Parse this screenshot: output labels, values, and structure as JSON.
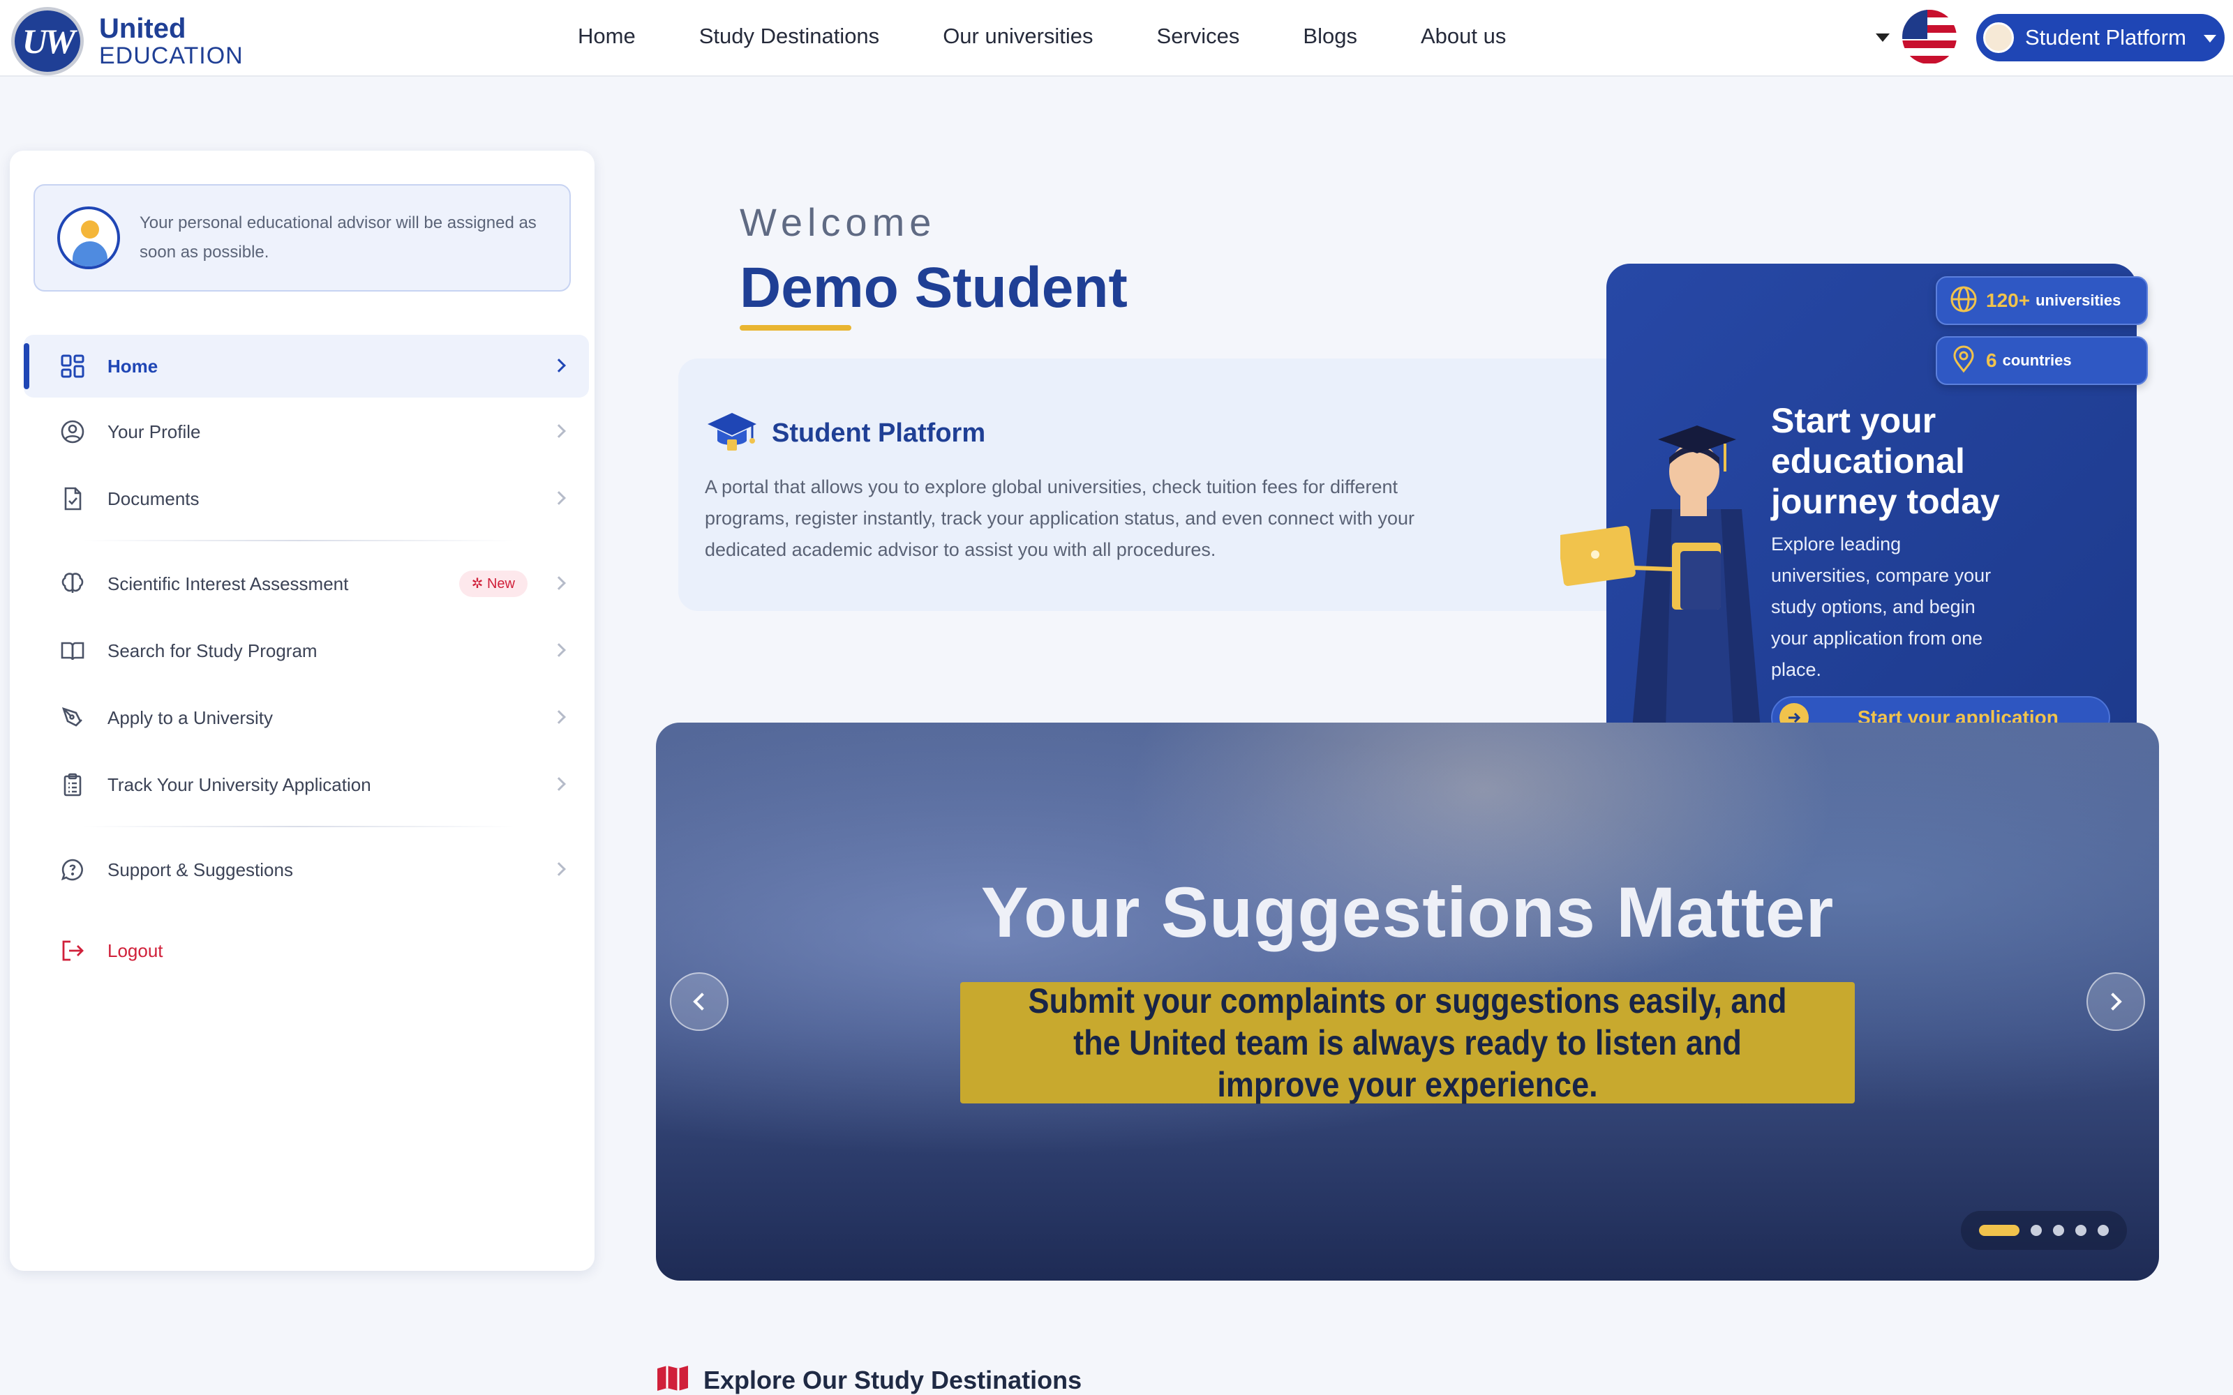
{
  "logo": {
    "line1": "United",
    "line2": "EDUCATION",
    "mark": "UW"
  },
  "nav": {
    "links": [
      "Home",
      "Study Destinations",
      "Our universities",
      "Services",
      "Blogs",
      "About us"
    ],
    "language_icon": "us-flag-icon",
    "platform_button": "Student Platform"
  },
  "sidebar": {
    "advisor_message": "Your personal educational advisor will be assigned as soon as possible.",
    "items": [
      {
        "label": "Home",
        "icon": "dashboard-grid-icon",
        "active": true
      },
      {
        "label": "Your Profile",
        "icon": "user-circle-icon"
      },
      {
        "label": "Documents",
        "icon": "document-check-icon"
      },
      {
        "label": "Scientific Interest Assessment",
        "icon": "brain-icon",
        "badge": "New"
      },
      {
        "label": "Search for Study Program",
        "icon": "open-book-icon"
      },
      {
        "label": "Apply to a University",
        "icon": "pen-tool-icon"
      },
      {
        "label": "Track Your University Application",
        "icon": "clipboard-list-icon"
      },
      {
        "label": "Support & Suggestions",
        "icon": "chat-bubble-icon"
      },
      {
        "label": "Logout",
        "icon": "logout-icon"
      }
    ]
  },
  "welcome": {
    "label": "Welcome",
    "name": "Demo Student"
  },
  "intro": {
    "title": "Student Platform",
    "text": "A portal that allows you to explore global universities, check tuition fees for different programs, register instantly, track your application status, and even connect with your dedicated academic advisor to assist you with all procedures."
  },
  "promo": {
    "stats": [
      {
        "value": "120+",
        "unit": "universities",
        "icon": "globe-icon"
      },
      {
        "value": "6",
        "unit": "countries",
        "icon": "location-pin-icon"
      }
    ],
    "title": "Start your educational journey today",
    "text": "Explore leading universities, compare your study options, and begin your application from one place.",
    "button": "Start your application"
  },
  "banner": {
    "title": "Your Suggestions Matter",
    "subtitle": "Submit your complaints or suggestions easily, and the United team is always ready to listen and improve your experience.",
    "slide_count": 5,
    "active_slide": 1
  },
  "section": {
    "title": "Explore Our Study Destinations",
    "icon": "map-icon"
  },
  "colors": {
    "brand": "#1f3f95",
    "accent": "#f1c34c",
    "danger": "#d0203a"
  }
}
